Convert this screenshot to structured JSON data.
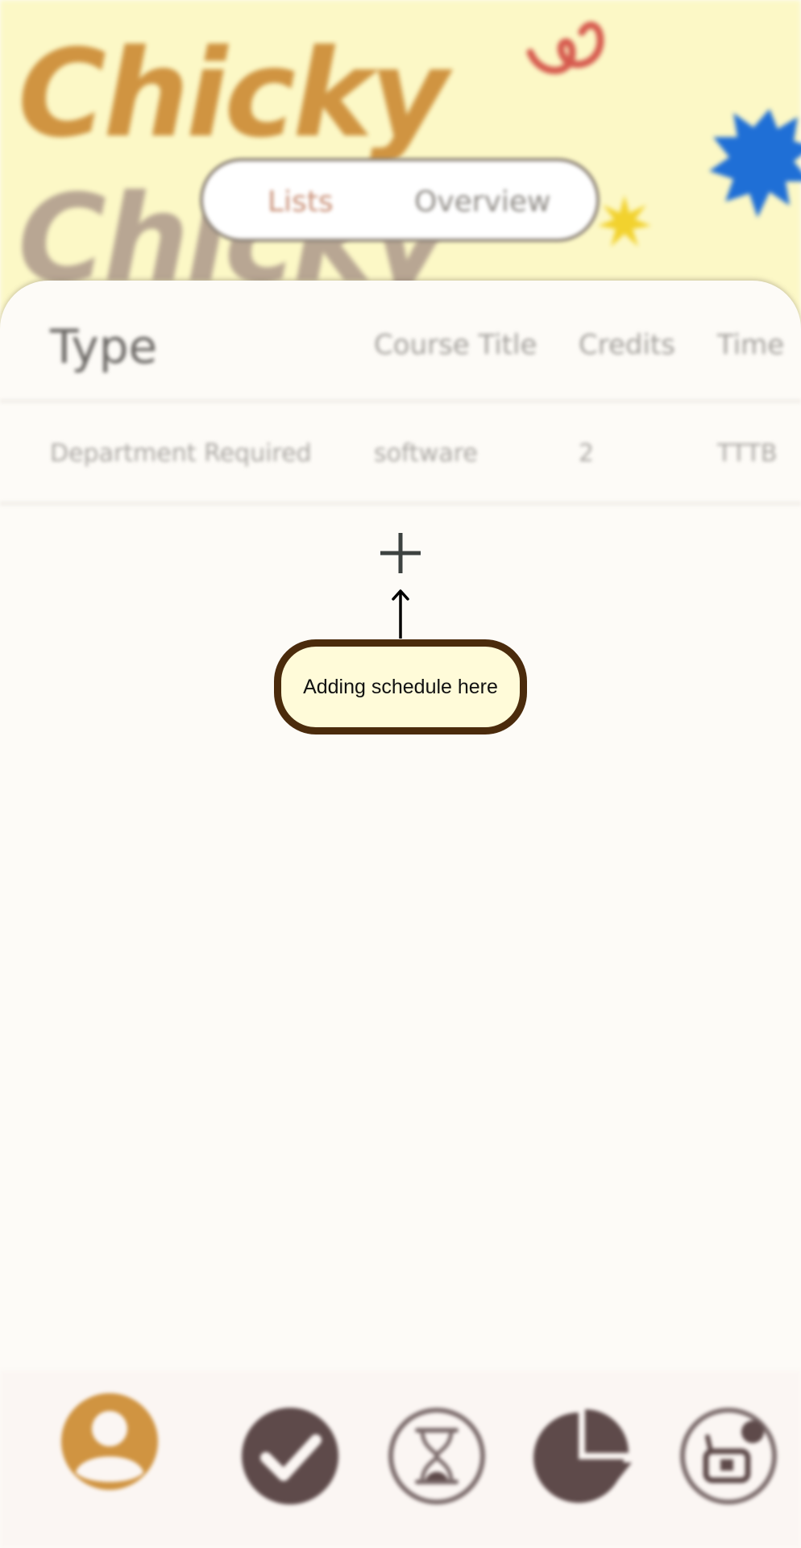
{
  "app": {
    "logo_text": "Chicky",
    "logo_text_shadow": "Chicky"
  },
  "segmented_control": {
    "tabs": [
      {
        "label": "Lists",
        "active": true
      },
      {
        "label": "Overview",
        "active": false
      }
    ]
  },
  "table": {
    "headers": [
      "Type",
      "Course Title",
      "Credits",
      "Time"
    ],
    "rows": [
      [
        "Department Required",
        "software",
        "2",
        "TTTB"
      ]
    ]
  },
  "add_button": {
    "icon": "plus-icon"
  },
  "tooltip": {
    "text": "Adding schedule here"
  },
  "bottom_nav": {
    "items": [
      {
        "icon": "profile-icon",
        "active": true
      },
      {
        "icon": "checkmark-icon",
        "active": false
      },
      {
        "icon": "hourglass-icon",
        "active": false
      },
      {
        "icon": "pie-chart-icon",
        "active": false
      },
      {
        "icon": "radio-icon",
        "active": false
      }
    ]
  },
  "colors": {
    "header_bg": "#fcf8c6",
    "logo": "#d09441",
    "accent_tab": "#c99077",
    "tooltip_border": "#4b2b0c",
    "tooltip_bg": "#fffbd9",
    "nav_active": "#d09441",
    "nav_inactive": "#5e4a4a"
  }
}
